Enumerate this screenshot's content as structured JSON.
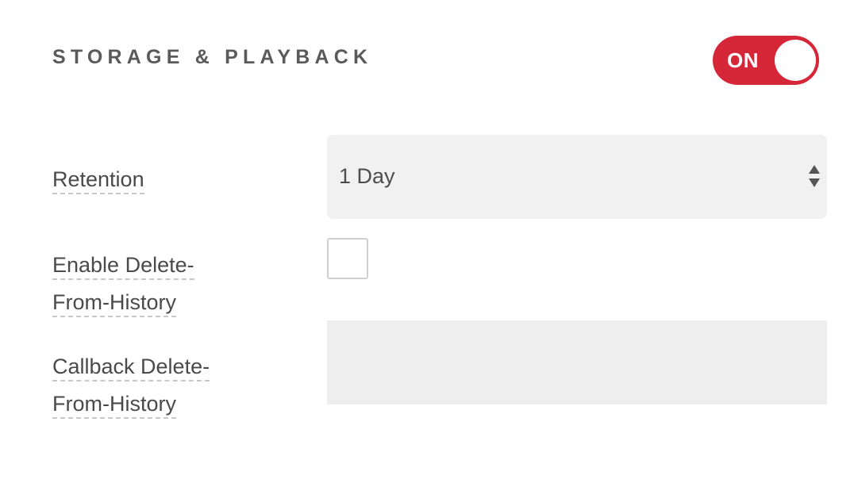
{
  "section": {
    "title": "STORAGE & PLAYBACK",
    "toggle": {
      "label": "ON",
      "state": true,
      "color": "#d62738"
    }
  },
  "fields": {
    "retention": {
      "label": "Retention",
      "selected": "1 Day"
    },
    "enable_delete": {
      "label_line1": "Enable Delete-",
      "label_line2": "From-History",
      "checked": false
    },
    "callback_delete": {
      "label_line1": "Callback Delete-",
      "label_line2": "From-History",
      "value": ""
    }
  }
}
